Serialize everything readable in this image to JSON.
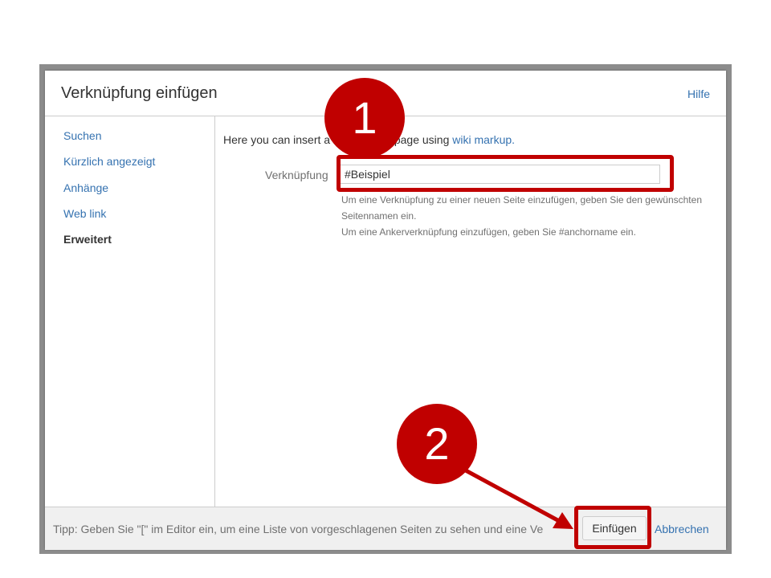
{
  "dialog": {
    "title": "Verknüpfung einfügen",
    "help": "Hilfe"
  },
  "nav": {
    "items": [
      {
        "label": "Suchen",
        "active": false
      },
      {
        "label": "Kürzlich angezeigt",
        "active": false
      },
      {
        "label": "Anhänge",
        "active": false
      },
      {
        "label": "Web link",
        "active": false
      },
      {
        "label": "Erweitert",
        "active": true
      }
    ]
  },
  "advanced": {
    "intro_prefix": "Here you can insert a",
    "intro_middle": "page using",
    "intro_link": "wiki markup.",
    "field_label": "Verknüpfung",
    "field_value": "#Beispiel",
    "hint_lines": [
      "Um eine Verknüpfung zu einer neuen Seite einzufügen, geben Sie den gewünschten",
      "Seitennamen ein.",
      "Um eine Ankerverknüpfung einzufügen, geben Sie #anchorname ein."
    ]
  },
  "footer": {
    "tip": "Tipp: Geben Sie \"[\" im Editor ein, um eine Liste von vorgeschlagenen Seiten zu sehen und eine Ve",
    "insert_label": "Einfügen",
    "cancel_label": "Abbrechen"
  },
  "annotations": {
    "step1": "1",
    "step2": "2",
    "color": "#c00000"
  }
}
